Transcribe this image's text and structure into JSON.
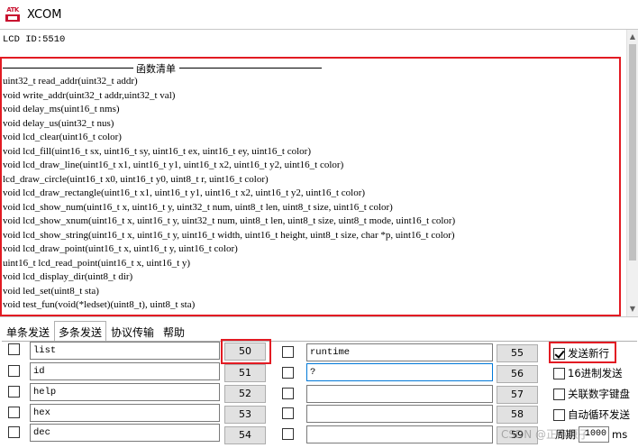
{
  "window": {
    "logo_text": "ATK",
    "title": "XCOM"
  },
  "terminal": {
    "lcd_id_line": "LCD ID:5510",
    "func_header": "函数清单",
    "functions": [
      "uint32_t read_addr(uint32_t addr)",
      "void write_addr(uint32_t addr,uint32_t val)",
      "void delay_ms(uint16_t nms)",
      "void delay_us(uint32_t nus)",
      "void lcd_clear(uint16_t color)",
      "void lcd_fill(uint16_t sx, uint16_t sy, uint16_t ex, uint16_t ey, uint16_t color)",
      "void lcd_draw_line(uint16_t x1, uint16_t y1, uint16_t x2, uint16_t y2, uint16_t color)",
      "lcd_draw_circle(uint16_t x0, uint16_t y0, uint8_t r, uint16_t color)",
      "void lcd_draw_rectangle(uint16_t x1, uint16_t y1, uint16_t x2, uint16_t y2, uint16_t color)",
      "void lcd_show_num(uint16_t x, uint16_t y, uint32_t num, uint8_t len, uint8_t size, uint16_t color)",
      "void lcd_show_xnum(uint16_t x, uint16_t y, uint32_t num, uint8_t len, uint8_t size, uint8_t mode, uint16_t color)",
      "void lcd_show_string(uint16_t x, uint16_t y, uint16_t width, uint16_t height, uint8_t size, char *p, uint16_t color)",
      "void lcd_draw_point(uint16_t x, uint16_t y, uint16_t color)",
      "uint16_t lcd_read_point(uint16_t x, uint16_t y)",
      "void lcd_display_dir(uint8_t dir)",
      "void led_set(uint8_t sta)",
      "void test_fun(void(*ledset)(uint8_t), uint8_t sta)"
    ]
  },
  "tabs": [
    {
      "label": "单条发送",
      "active": false
    },
    {
      "label": "多条发送",
      "active": true
    },
    {
      "label": "协议传输",
      "active": false
    },
    {
      "label": "帮助",
      "active": false
    }
  ],
  "multi_send": {
    "left": [
      {
        "text": "list",
        "button": "50"
      },
      {
        "text": "id",
        "button": "51"
      },
      {
        "text": "help",
        "button": "52"
      },
      {
        "text": "hex",
        "button": "53"
      },
      {
        "text": "dec",
        "button": "54"
      }
    ],
    "right": [
      {
        "text": "runtime",
        "button": "55"
      },
      {
        "text": "?",
        "button": "56"
      },
      {
        "text": "",
        "button": "57"
      },
      {
        "text": "",
        "button": "58"
      },
      {
        "text": "",
        "button": "59"
      }
    ]
  },
  "options": {
    "send_newline": "发送新行",
    "hex_send": "16进制发送",
    "link_keyboard": "关联数字键盘",
    "auto_loop": "自动循环发送",
    "period_label": "周期",
    "period_value": "1000",
    "period_unit": "ms"
  },
  "watermark": "CSDN @正点原子",
  "colors": {
    "highlight": "#e21b23",
    "focus": "#0078d7"
  }
}
